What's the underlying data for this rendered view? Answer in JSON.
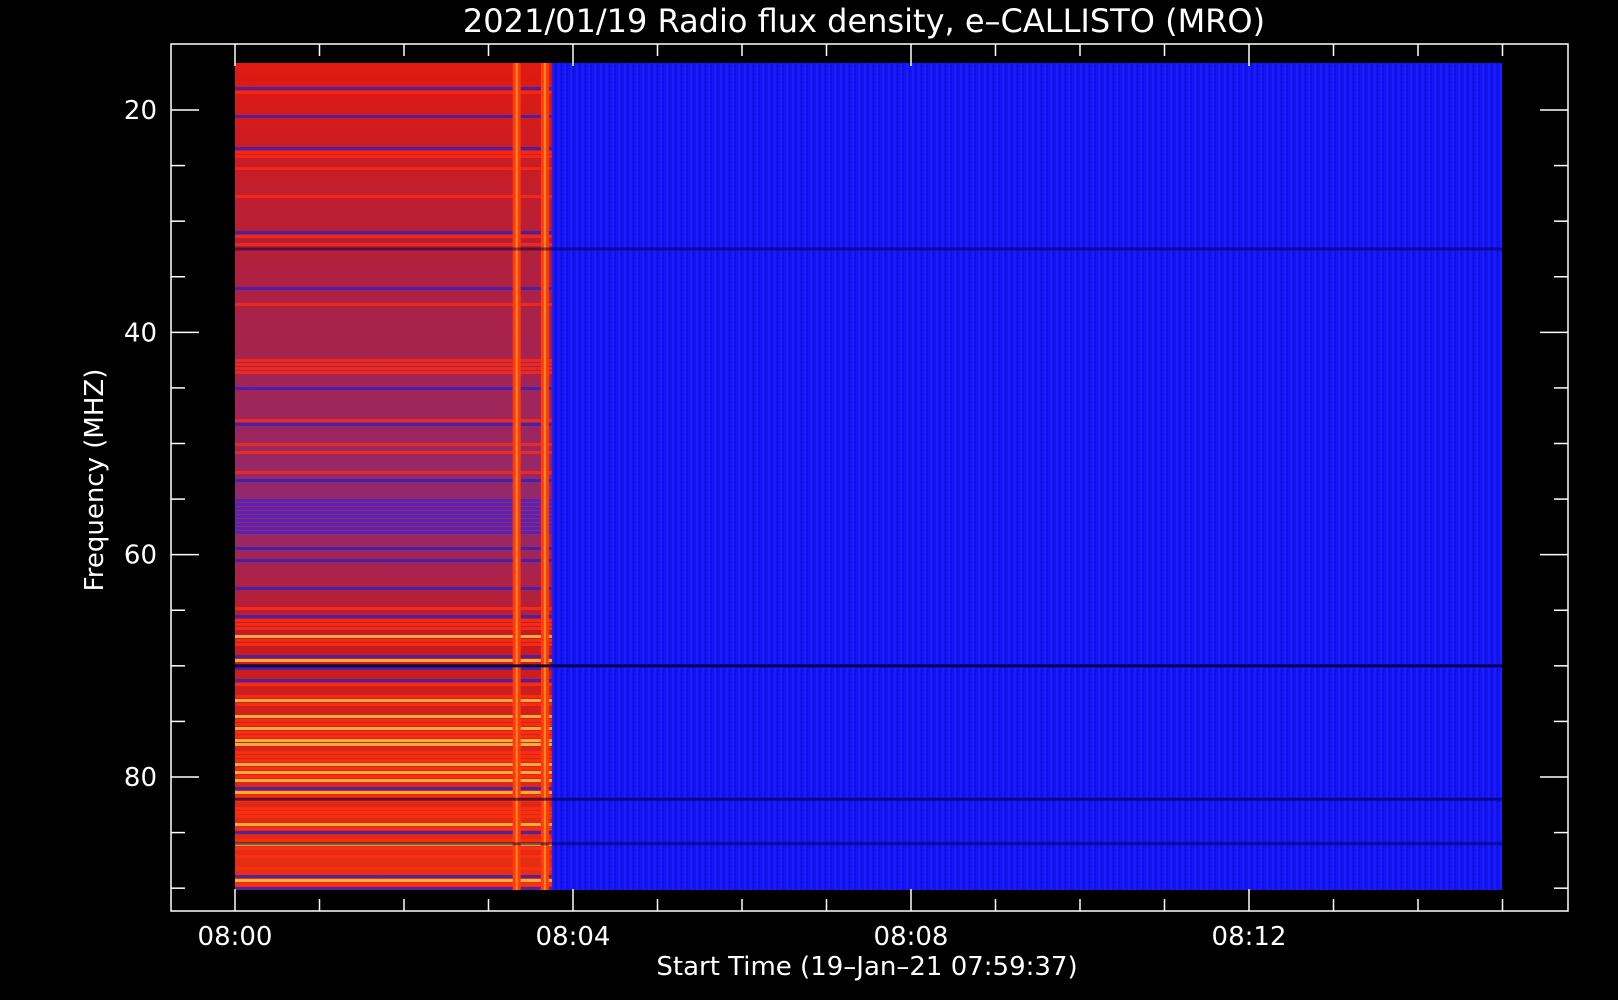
{
  "chart_data": {
    "type": "heatmap",
    "title": "2021/01/19  Radio flux density, e–CALLISTO (MRO)",
    "xlabel": "Start Time (19–Jan–21 07:59:37)",
    "ylabel": "Frequency (MHZ)",
    "x_ticks": [
      "08:00",
      "08:04",
      "08:08",
      "08:12"
    ],
    "y_ticks": [
      "20",
      "40",
      "60",
      "80"
    ],
    "x_range": [
      "08:00",
      "08:15"
    ],
    "y_range": [
      16,
      90
    ],
    "y_axis_inverted": true,
    "colormap": [
      "#000000",
      "#0000ff",
      "#ff0000",
      "#ffff00",
      "#ffffff"
    ],
    "background": "#000000",
    "regions": [
      {
        "start": "08:00",
        "end": "08:03:45",
        "level": "high",
        "color": "#cc1a1a"
      },
      {
        "start": "08:03:45",
        "end": "08:15",
        "level": "low",
        "color": "#1a1aff"
      }
    ],
    "features": [
      {
        "type": "vertical-burst",
        "time": "08:03:20"
      },
      {
        "type": "vertical-burst",
        "time": "08:03:40"
      }
    ]
  }
}
